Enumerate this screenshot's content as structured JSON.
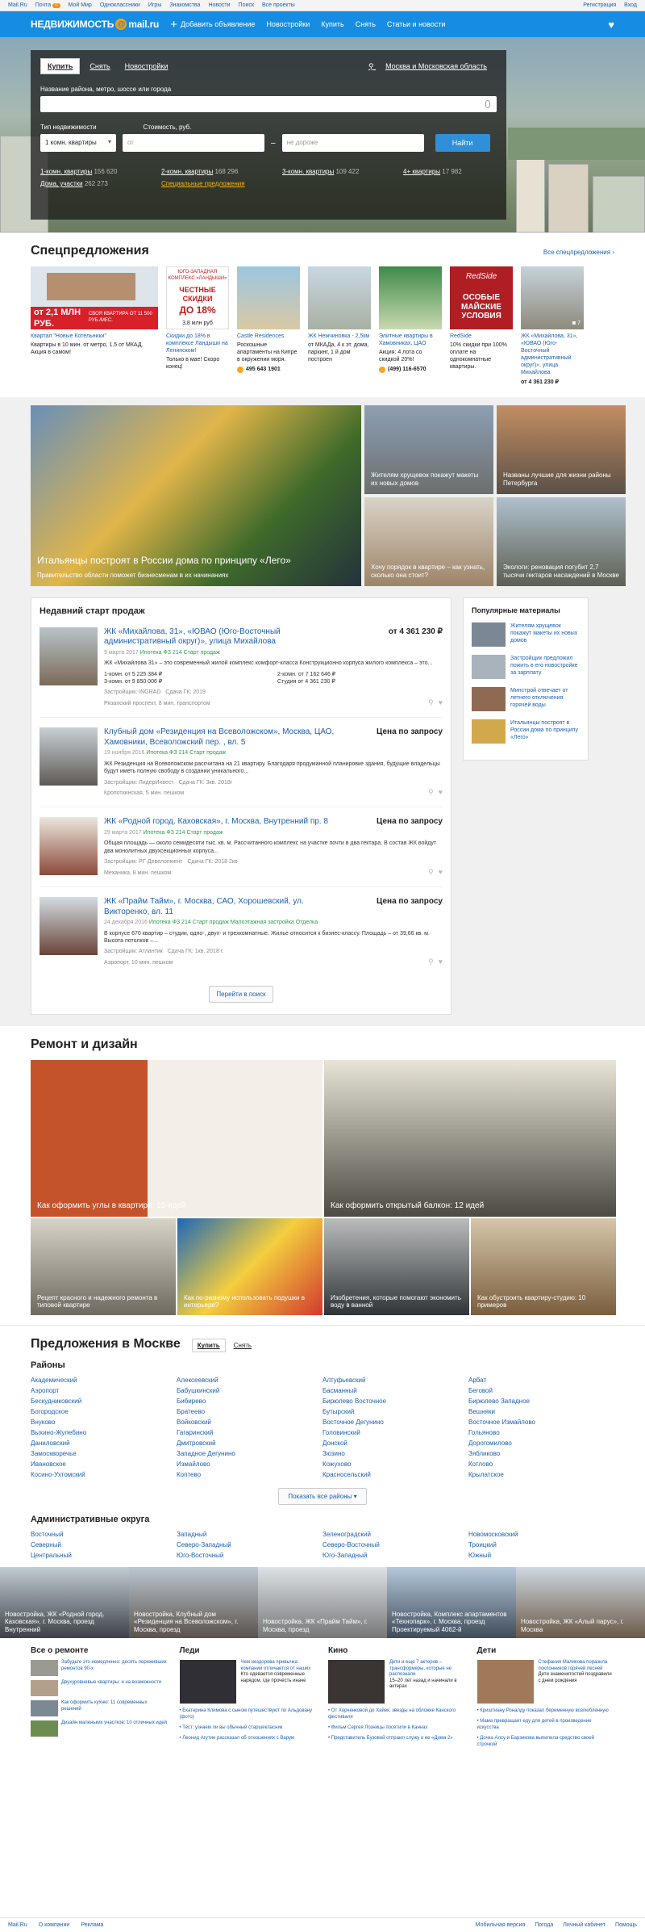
{
  "topbar": {
    "items": [
      "Mail.Ru",
      "Почта",
      "Мой Мир",
      "Одноклассники",
      "Игры",
      "Знакомства",
      "Новости",
      "Поиск",
      "Все проекты"
    ],
    "mail_badge": "0",
    "right": [
      "Регистрация",
      "Вход"
    ]
  },
  "nav": {
    "logo_text": "НЕДВИЖИМОСТЬ",
    "logo_domain": "mail.ru",
    "add": "Добавить объявление",
    "links": [
      "Новостройки",
      "Купить",
      "Снять",
      "Статьи и новости"
    ]
  },
  "search": {
    "tabs": [
      "Купить",
      "Снять",
      "Новостройки"
    ],
    "location": "Москва и Московская область",
    "query_label": "Название района, метро, шоссе или города",
    "type_label": "Тип недвижимости",
    "price_label": "Стоимость, руб.",
    "type_value": "1 комн. квартиры",
    "from_ph": "от",
    "to_ph": "не дороже",
    "find": "Найти",
    "links": [
      {
        "l": "1-комн. квартиры",
        "n": "156 620"
      },
      {
        "l": "2-комн. квартиры",
        "n": "168 296"
      },
      {
        "l": "3-комн. квартиры",
        "n": "109 422"
      },
      {
        "l": "4+ квартиры",
        "n": "17 982"
      },
      {
        "l": "Дома, участки",
        "n": "262 273"
      },
      {
        "l": "Специальные предложения",
        "n": ""
      }
    ]
  },
  "specials": {
    "title": "Спецпредложения",
    "all": "Все спецпредложения",
    "items": [
      {
        "t": "Квартал \"Новые Котельники\"",
        "d": "Квартиры в 10 мин. от метро, 1,5 от МКАД. Акция в самом!",
        "ad_big": "от 2,1 МЛН РУБ.",
        "ad_small": "СВОЯ КВАРТИРА ОТ 11 500 РУБ./МЕС."
      },
      {
        "t": "Скидки до 18% в комплексе Ландыши на Ленинском!",
        "d": "Только в мае! Скоро конец!",
        "ad_small": "ЮГО-ЗАПАДНАЯ КОМПЛЕКС «ЛАНДЫШИ»",
        "ad_big": "ЧЕСТНЫЕ СКИДКИ",
        "ad_pct": "ДО 18%",
        "ad_price": "3,8 млн руб"
      },
      {
        "t": "Castle Residences",
        "d": "Роскошные апартаменты на Кипре в окружении моря.",
        "phone": "495 643 1901"
      },
      {
        "t": "ЖК Немчиновка - 2,5км",
        "d": "от МКАДа, 4 к эт. дома, паркинг, 1 й дом построен"
      },
      {
        "t": "Элитные квартиры в Хамовниках, ЦАО",
        "d": "Акция: 4 лота со скидкой 20%!",
        "phone": "(499) 116-6570"
      },
      {
        "t": "RedSide",
        "d": "10% скидки при 100% оплате на однокомнатные квартиры.",
        "ad_small": "RedSide",
        "ad_big": "ОСОБЫЕ МАЙСКИЕ УСЛОВИЯ"
      },
      {
        "t": "ЖК «Михайлова, 31», «ЮВАО (Юго-Восточный административный округ)», улица Михайлова",
        "price": "от 4 361 230 ₽",
        "badge": "7"
      }
    ]
  },
  "news": [
    {
      "t": "Итальянцы построят в России дома по принципу «Лего»",
      "s": "Правительство области поможет бизнесменам в их начинаниях"
    },
    {
      "t": "Жителям хрущевок покажут макеты их новых домов"
    },
    {
      "t": "Названы лучшие для жизни районы Петербурга"
    },
    {
      "t": "Хочу порядок в квартире – как узнать, сколько она стоит?"
    },
    {
      "t": "Экологи: реновация погубит 2,7 тысячи гектаров насаждений в Москве"
    }
  ],
  "starts": {
    "title": "Недавний старт продаж",
    "more": "Перейти в поиск",
    "items": [
      {
        "t": "ЖК «Михайлова, 31», «ЮВАО (Юго-Восточный административный округ)», улица Михайлова",
        "price": "от 4 361 230 ₽",
        "date": "9 марта 2017",
        "m1": "Ипотека",
        "m2": "ФЗ 214",
        "m3": "Старт продаж",
        "d": "ЖК «Михайлова 31» – это современный жилой комплекс комфорт-класса Конструкционно корпуса жилого комплекса – это...",
        "p": [
          "1-комн. от 5 225 384 ₽",
          "2-комн. от 7 162 646 ₽",
          "3-комн. от 9 850 006 ₽",
          "Студия от 4 361 230 ₽"
        ],
        "dev": "Застройщик: INGRAD",
        "year": "Сдача ГК: 2019",
        "addr": "Рязанский проспект, 8 мин. транспортом",
        "count": "7"
      },
      {
        "t": "Клубный дом «Резиденция на Всеволожском», Москва, ЦАО, Хамовники, Всеволожский пер. , вл. 5",
        "price": "Цена по запросу",
        "date": "19 ноября 2016",
        "m1": "Ипотека",
        "m2": "ФЗ 214",
        "m3": "Старт продаж",
        "d": "ЖК Резиденция на Всеволожском рассчитана на 21 квартиру. Благодаря продуманной планировке здания, будущие владельцы будут иметь полную свободу в создании уникального...",
        "dev": "Застройщик: ЛидерИнвест",
        "year": "Сдача ГК: 3кв. 2018г",
        "addr": "Кропоткинская, 5 мин. пешком"
      },
      {
        "t": "ЖК «Родной город. Каховская», г. Москва, Внутренний пр. 8",
        "price": "Цена по запросу",
        "date": "29 марта 2017",
        "m1": "Ипотека",
        "m2": "ФЗ 214",
        "m3": "Старт продаж",
        "d": "Общая площадь — около семидесяти тыс. кв. м. Рассчитанного комплекс на участке почти в два гектара. В состав ЖК войдут два монолитных двухсекционных корпуса...",
        "dev": "Застройщик: РГ-Девелопмент",
        "year": "Сдача ГК: 2018 2кв",
        "addr": "Механика, 8 мин. пешком"
      },
      {
        "t": "ЖК «Прайм Тайм», г. Москва, САО, Хорошевский, ул. Викторенко, вл. 11",
        "price": "Цена по запросу",
        "date": "24 декабря 2016",
        "m1": "Ипотека",
        "m2": "ФЗ 214",
        "m3": "Старт продаж",
        "m4": "Малоэтажная застройка",
        "m5": "Отделка",
        "d": "В корпусе 670 квартир – студии, одно-, двух- и трехкомнатные. Жилье относится к бизнес-классу. Площадь – от 39,66 кв. м. Высота потолков –...",
        "dev": "Застройщик: Атлантик",
        "year": "Сдача ГК: 1кв. 2018 г.",
        "addr": "Аэропорт, 10 мин. пешком"
      }
    ]
  },
  "popular": {
    "title": "Популярные материалы",
    "items": [
      "Жителям хрущевок покажут макеты их новых домов",
      "Застройщик предложил пожить в его новостройке за зарплату",
      "Минстрой отвечает от летнего отключения горячей воды",
      "Итальянцы построят в России дома по принципу «Лего»"
    ]
  },
  "repair": {
    "title": "Ремонт и дизайн",
    "items": [
      "Как оформить углы в квартире: 15 идей",
      "Как оформить открытый балкон: 12 идей",
      "Рецепт красного и надежного ремонта в типовой квартире",
      "Как по-разному использовать подушки в интерьере?",
      "Изобретения, которые помогают экономить воду в ванной",
      "Как обустроить квартиру-студию: 10 примеров"
    ]
  },
  "offers": {
    "title": "Предложения в Москве",
    "tabs": [
      "Купить",
      "Снять"
    ],
    "districts_title": "Районы",
    "districts": [
      [
        "Академический",
        "Аэропорт",
        "Бескудниковский",
        "Богородское",
        "Внуково",
        "Выхино-Жулебино",
        "Даниловский",
        "Замоскворечье",
        "Ивановское",
        "Косино-Ухтомский"
      ],
      [
        "Алексеевский",
        "Бабушкинский",
        "Бибирево",
        "Братеево",
        "Войковский",
        "Гагаринский",
        "Дмитровский",
        "Западное Дегунино",
        "Измайлово",
        "Коптево"
      ],
      [
        "Алтуфьевский",
        "Басманный",
        "Бирюлево Восточное",
        "Бутырский",
        "Восточное Дегунино",
        "Головинский",
        "Донской",
        "Зюзино",
        "Кожухово",
        "Красносельский"
      ],
      [
        "Арбат",
        "Беговой",
        "Бирюлево Западное",
        "Вешняки",
        "Восточное Измайлово",
        "Гольяново",
        "Дорогомилово",
        "Зябликово",
        "Котлово",
        "Крылатское"
      ]
    ],
    "show_all": "Показать все районы",
    "okrug_title": "Административные округа",
    "okrugs": [
      [
        "Восточный",
        "Северный",
        "Центральный"
      ],
      [
        "Западный",
        "Северо-Западный",
        "Юго-Восточный"
      ],
      [
        "Зеленоградский",
        "Северо-Восточный",
        "Юго-Западный"
      ],
      [
        "Новомосковский",
        "Троицкий",
        "Южный"
      ]
    ]
  },
  "strip": [
    "Новостройка, ЖК «Родной город. Каховская», г. Москва, проезд Внутренний",
    "Новостройка, Клубный дом «Резиденция на Всеволожском», г. Москва, проезд",
    "Новостройка, ЖК «Прайм Тайм», г. Москва, проезд",
    "Новостройка, Комплекс апартаментов «Технопарк», г. Москва, проезд Проектируемый 4062-й",
    "Новостройка, ЖК «Алый парус», г. Москва"
  ],
  "blocks": {
    "b1": {
      "h": "Все о ремонте",
      "items": [
        "Забудьте это немедленно: десять переживших ремонтов 90-х",
        "Двухуровневые квартиры: и на возможности",
        "Как оформить кухню: 11 современных решений",
        "Дизайн маленьких участков: 10 отличных идей"
      ]
    },
    "b2": {
      "h": "Леди",
      "lead": "Чем нездорова привычка компании отличается от наших",
      "lead2": "Кто одевается современные нарядом, где прочесть иначе",
      "list": [
        "Екатерина Климова с сыном путешествуют по Альдовану (фото)",
        "Тест: узнаем ли вы обычный старшекласник",
        "Леонид Агутин рассказал об отношениях с Варум"
      ]
    },
    "b3": {
      "h": "Кино",
      "lead": "Дети и еще 7 актеров – трансформеры, которые не распознали",
      "lead2": "15–20 лет назад и начинали в актерах",
      "list": [
        "От Хорченковой до Хайек: звезды на обложке Канского фестиваля",
        "Фильм Сергея Лозницы посетили в Каннах",
        "Представитель Бузовой отпраил служу о ее «Дома 2»"
      ]
    },
    "b4": {
      "h": "Дети",
      "lead": "Стефания Маликова поразила поклонников горячей песней",
      "lead2": "Дети знаменитостей поздравили с днем рождения",
      "list": [
        "Криштиану Роналду показал беременную возлюбленную",
        "Мама превращает еду для детей в произведение искусства",
        "Дочка Алсу и Барзикова выпилила средство своей строчкой"
      ]
    }
  },
  "footer": {
    "left": [
      "Mail.Ru",
      "О компании",
      "Реклама"
    ],
    "right": [
      "Мобильная версия",
      "Погода",
      "Личный кабинет",
      "Помощь"
    ]
  }
}
